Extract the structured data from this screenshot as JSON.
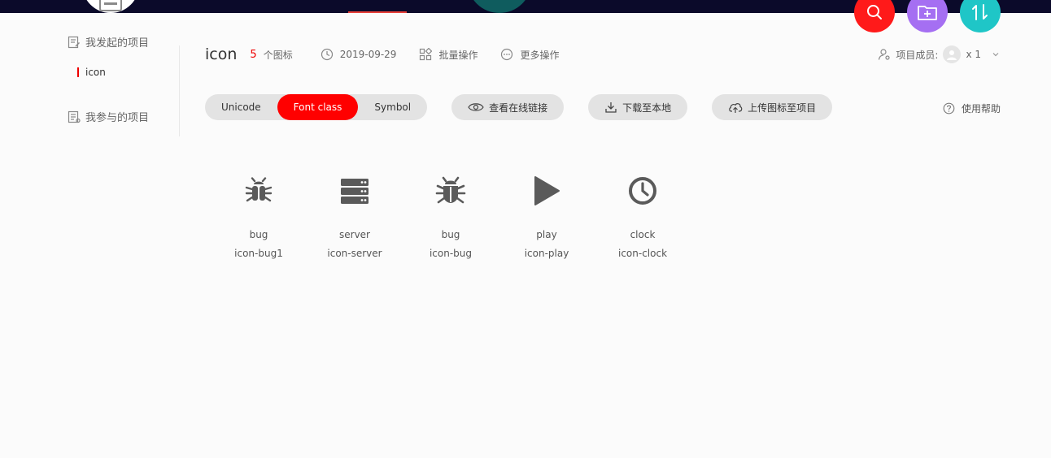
{
  "sidebar": {
    "my_projects": "我发起的项目",
    "joined_projects": "我参与的项目",
    "items": [
      {
        "label": "icon"
      }
    ]
  },
  "project": {
    "title": "icon",
    "icon_count": "5",
    "icon_count_label": "个图标",
    "date": "2019-09-29",
    "batch_label": "批量操作",
    "more_label": "更多操作",
    "members_label": "项目成员:",
    "members_count": "x 1"
  },
  "toolbar": {
    "tabs": [
      {
        "label": "Unicode"
      },
      {
        "label": "Font class"
      },
      {
        "label": "Symbol"
      }
    ],
    "active_tab": "Font class",
    "view_link_label": "查看在线链接",
    "download_label": "下载至本地",
    "upload_label": "上传图标至项目",
    "help_label": "使用帮助"
  },
  "icons": [
    {
      "name": "bug",
      "class": "icon-bug1",
      "glyph": "bug-icon"
    },
    {
      "name": "server",
      "class": "icon-server",
      "glyph": "server-icon"
    },
    {
      "name": "bug",
      "class": "icon-bug",
      "glyph": "bug-icon"
    },
    {
      "name": "play",
      "class": "icon-play",
      "glyph": "play-icon"
    },
    {
      "name": "clock",
      "class": "icon-clock",
      "glyph": "clock-icon"
    }
  ],
  "colors": {
    "accent": "#ff0000",
    "search_fab": "#ff1a1a",
    "folder_fab": "#a56ff2",
    "sort_fab": "#1fc6c7",
    "topbar": "#0b0a2a"
  }
}
